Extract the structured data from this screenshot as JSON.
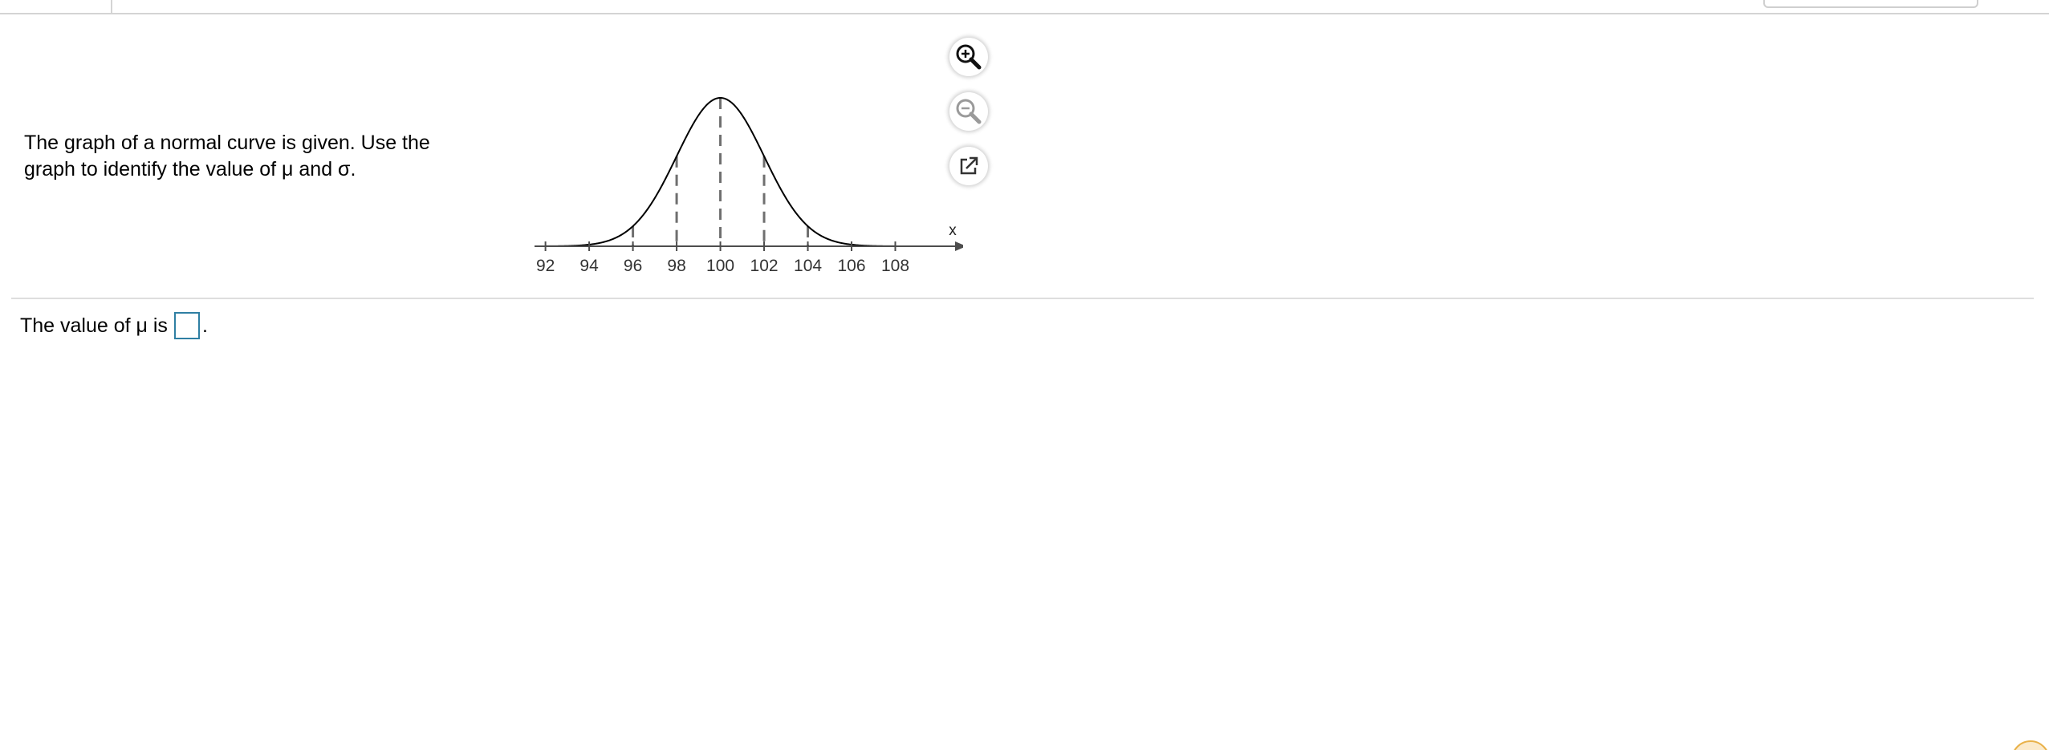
{
  "question": {
    "text": "The graph of a normal curve is given. Use the graph to identify the value of μ and σ."
  },
  "chart_data": {
    "type": "line",
    "title": "",
    "xlabel": "x",
    "ylabel": "",
    "xlim": [
      91.5,
      110
    ],
    "mean": 100,
    "sd": 2,
    "x_ticks": [
      92,
      94,
      96,
      98,
      100,
      102,
      104,
      106,
      108
    ],
    "dashed_lines_at": [
      96,
      98,
      100,
      102,
      104
    ],
    "grid": false,
    "legend": "none",
    "series": [
      {
        "name": "",
        "x": [
          92,
          93,
          94,
          95,
          96,
          97,
          98,
          99,
          100,
          101,
          102,
          103,
          104,
          105,
          106,
          107,
          108
        ],
        "y": [
          0.0003,
          0.0022,
          0.0111,
          0.0438,
          0.1353,
          0.3247,
          0.6065,
          0.8825,
          1.0,
          0.8825,
          0.6065,
          0.3247,
          0.1353,
          0.0438,
          0.0111,
          0.0022,
          0.0003
        ]
      }
    ]
  },
  "tools": {
    "zoom_in_icon": "zoom-in-icon",
    "zoom_out_icon": "zoom-out-icon",
    "popout_icon": "external-link-icon"
  },
  "answer": {
    "prefix": "The value of μ is",
    "suffix": "."
  },
  "colors": {
    "answer_box_border": "#2f7fa3",
    "dashed_line": "#6f6f6f",
    "axis": "#4d4d4d"
  }
}
